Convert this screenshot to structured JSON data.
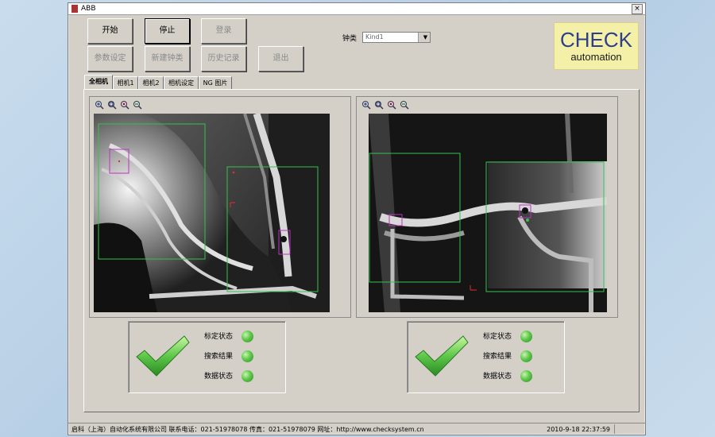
{
  "window": {
    "title": "ABB",
    "close_glyph": "×"
  },
  "toolbar": {
    "start_label": "开始",
    "stop_label": "停止",
    "login_label": "登录",
    "params_label": "参数设定",
    "new_type_label": "新建钟类",
    "history_label": "历史记录",
    "exit_label": "退出"
  },
  "type_select": {
    "label": "钟类",
    "value": "Kind1",
    "arrow_glyph": "▼"
  },
  "logo": {
    "line1": "CHECK",
    "line2": "automation"
  },
  "tabs": [
    "全相机",
    "相机1",
    "相机2",
    "相机设定",
    "NG 图片"
  ],
  "selected_tab": 0,
  "zoom_icons": [
    "zoom-in-icon",
    "zoom-fit-icon",
    "zoom-actual-icon",
    "zoom-out-icon"
  ],
  "camera_panels": [
    {
      "status_rows": [
        {
          "label": "标定状态",
          "state": "ok"
        },
        {
          "label": "搜索结果",
          "state": "ok"
        },
        {
          "label": "数据状态",
          "state": "ok"
        }
      ]
    },
    {
      "status_rows": [
        {
          "label": "标定状态",
          "state": "ok"
        },
        {
          "label": "搜索结果",
          "state": "ok"
        },
        {
          "label": "数据状态",
          "state": "ok"
        }
      ]
    }
  ],
  "colors": {
    "ok_green": "#5ec84a",
    "roi_green": "#33c24d",
    "roi_magenta": "#c030c0",
    "logo_bg": "#f4f0a8",
    "logo_text": "#2c3f8a"
  },
  "statusbar": {
    "company": "启科（上海）自动化系统有限公司  联系电话：021-51978078 传真：021-51978079 网址：http://www.checksystem.cn",
    "datetime": "2010-9-18   22:37:59"
  }
}
